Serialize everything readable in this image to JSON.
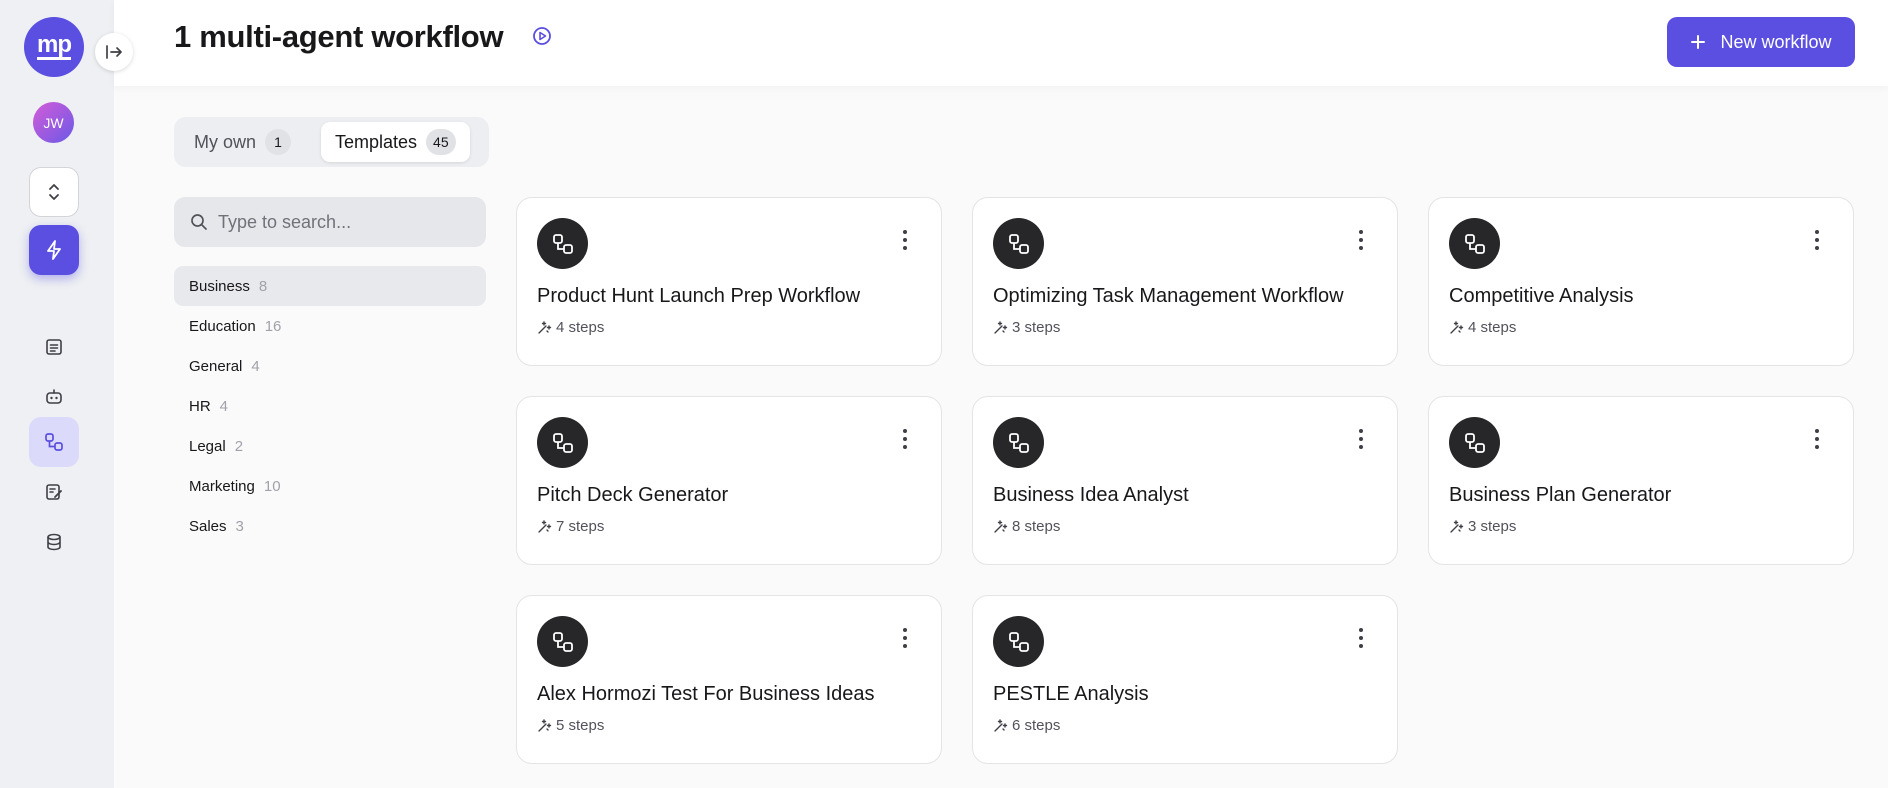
{
  "sidebar": {
    "logo_text": "mp",
    "avatar_initials": "JW",
    "icons": [
      "collapse-sidebar-icon",
      "switch-icon",
      "bolt-icon",
      "document-icon",
      "robot-icon",
      "workflow-icon",
      "notebook-edit-icon",
      "database-icon"
    ],
    "active_item": "workflows"
  },
  "header": {
    "title": "1 multi-agent workflow",
    "new_button_label": "New workflow"
  },
  "tabs": [
    {
      "label": "My own",
      "count": "1",
      "selected": false
    },
    {
      "label": "Templates",
      "count": "45",
      "selected": true
    }
  ],
  "search": {
    "placeholder": "Type to search...",
    "value": ""
  },
  "categories": [
    {
      "name": "Business",
      "count": "8",
      "active": true
    },
    {
      "name": "Education",
      "count": "16",
      "active": false
    },
    {
      "name": "General",
      "count": "4",
      "active": false
    },
    {
      "name": "HR",
      "count": "4",
      "active": false
    },
    {
      "name": "Legal",
      "count": "2",
      "active": false
    },
    {
      "name": "Marketing",
      "count": "10",
      "active": false
    },
    {
      "name": "Sales",
      "count": "3",
      "active": false
    }
  ],
  "workflows": [
    {
      "title": "Product Hunt Launch Prep Workflow",
      "steps": "4 steps"
    },
    {
      "title": "Optimizing Task Management Workflow",
      "steps": "3 steps"
    },
    {
      "title": "Competitive Analysis",
      "steps": "4 steps"
    },
    {
      "title": "Pitch Deck Generator",
      "steps": "7 steps"
    },
    {
      "title": "Business Idea Analyst",
      "steps": "8 steps"
    },
    {
      "title": "Business Plan Generator",
      "steps": "3 steps"
    },
    {
      "title": "Alex Hormozi Test For Business Ideas",
      "steps": "5 steps"
    },
    {
      "title": "PESTLE Analysis",
      "steps": "6 steps"
    }
  ],
  "colors": {
    "accent": "#5a4fe0",
    "card_icon_bg": "#27272a",
    "rail_bg": "#eef0f3"
  }
}
